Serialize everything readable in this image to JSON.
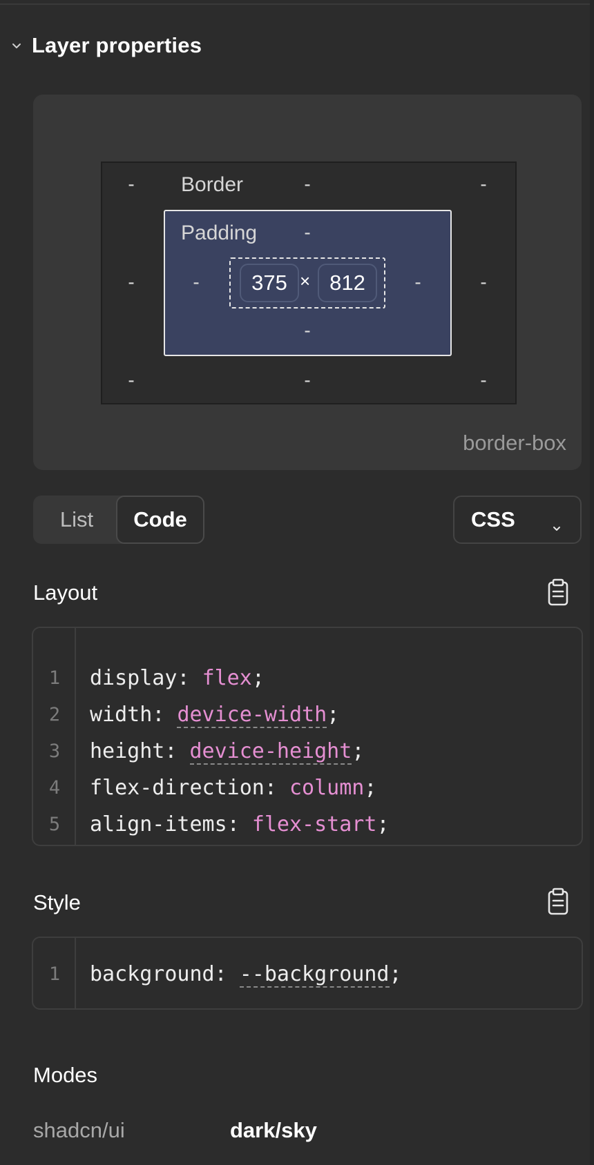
{
  "panel": {
    "title": "Layer properties",
    "collapse_icon": "chevron-down-icon"
  },
  "box_model": {
    "border_label": "Border",
    "padding_label": "Padding",
    "empty": "-",
    "width": "375",
    "height": "812",
    "separator": "×",
    "box_sizing": "border-box"
  },
  "view_toggle": {
    "options": [
      "List",
      "Code"
    ],
    "selected": "Code"
  },
  "language_select": {
    "value": "CSS",
    "icon": "chevron-down-icon"
  },
  "layout": {
    "title": "Layout",
    "copy_icon": "clipboard-icon",
    "lines": [
      {
        "n": "1",
        "prop": "display",
        "value": "flex"
      },
      {
        "n": "2",
        "prop": "width",
        "value": "device-width"
      },
      {
        "n": "3",
        "prop": "height",
        "value": "device-height"
      },
      {
        "n": "4",
        "prop": "flex-direction",
        "value": "column"
      },
      {
        "n": "5",
        "prop": "align-items",
        "value": "flex-start"
      }
    ]
  },
  "style": {
    "title": "Style",
    "copy_icon": "clipboard-icon",
    "lines": [
      {
        "n": "1",
        "prop": "background",
        "value": "--background"
      }
    ]
  },
  "modes": {
    "title": "Modes",
    "name": "shadcn/ui",
    "value": "dark/sky"
  },
  "colors": {
    "panel_bg": "#2c2c2c",
    "card_bg": "#383838",
    "padding_bg": "#3a4260",
    "code_value": "#e58fd2"
  }
}
